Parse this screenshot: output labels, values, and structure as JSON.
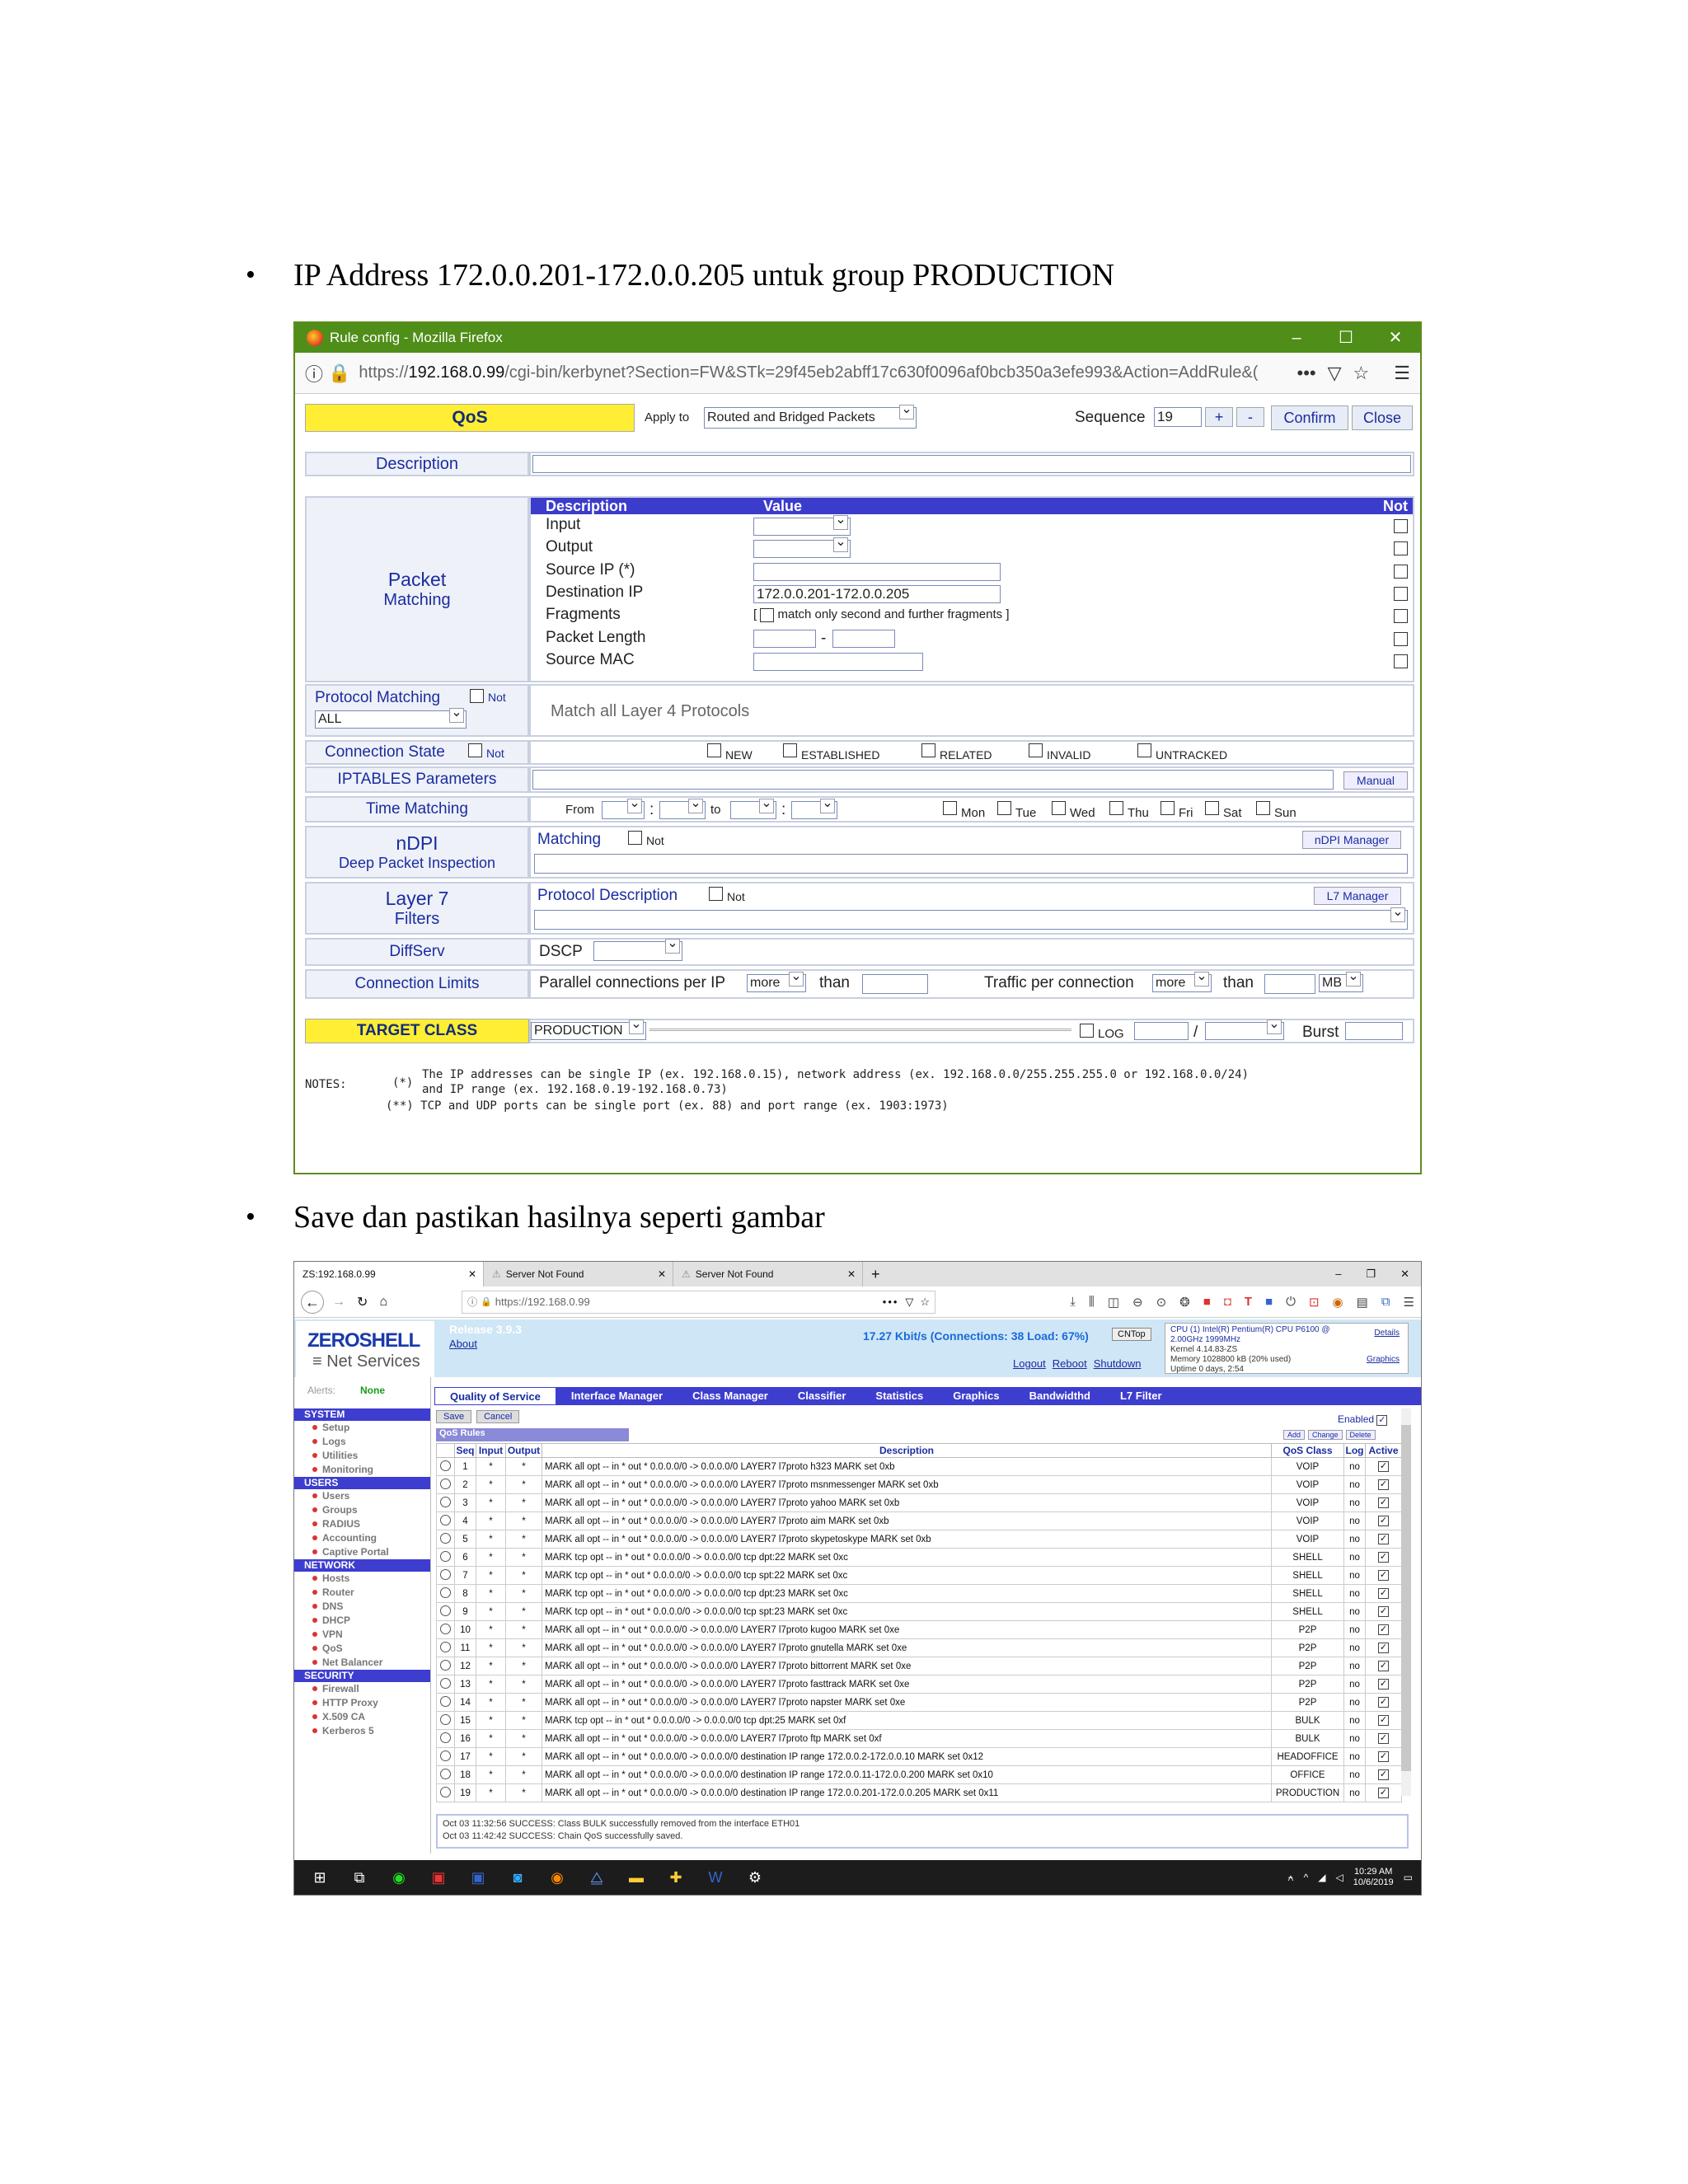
{
  "bullets": [
    "IP Address 172.0.0.201-172.0.0.205 untuk group PRODUCTION",
    "Save dan pastikan hasilnya seperti gambar"
  ],
  "win1": {
    "title": "Rule config - Mozilla Firefox",
    "url_prefix": "https://",
    "url_host": "192.168.0.99",
    "url_rest": "/cgi-bin/kerbynet?Section=FW&STk=29f45eb2abff17c630f0096af0bcb350a3efe993&Action=AddRule&(",
    "qos": "QoS",
    "apply_to": "Apply to",
    "apply_value": "Routed and Bridged Packets",
    "sequence_label": "Sequence",
    "sequence_value": "19",
    "plus": "+",
    "minus": "-",
    "confirm": "Confirm",
    "close": "Close",
    "description": "Description",
    "packet": "Packet",
    "matching": "Matching",
    "pm_head_desc": "Description",
    "pm_head_val": "Value",
    "pm_head_not": "Not",
    "pm_rows": [
      "Input",
      "Output",
      "Source IP (*)",
      "Destination IP",
      "Fragments",
      "Packet Length",
      "Source MAC"
    ],
    "dest_ip": "172.0.0.201-172.0.0.205",
    "frag_text": "match only second and further fragments",
    "protocol_matching": "Protocol Matching",
    "not": "Not",
    "proto_value": "ALL",
    "proto_desc": "Match all Layer 4 Protocols",
    "conn_state": "Connection State",
    "states": [
      "NEW",
      "ESTABLISHED",
      "RELATED",
      "INVALID",
      "UNTRACKED"
    ],
    "iptables": "IPTABLES Parameters",
    "manual": "Manual",
    "time_matching": "Time Matching",
    "from": "From",
    "to": "to",
    "days": [
      "Mon",
      "Tue",
      "Wed",
      "Thu",
      "Fri",
      "Sat",
      "Sun"
    ],
    "ndpi": "nDPI",
    "ndpi_sub": "Deep Packet Inspection",
    "ndpi_matching": "Matching",
    "ndpi_manager": "nDPI Manager",
    "layer7": "Layer 7",
    "filters": "Filters",
    "proto_description": "Protocol Description",
    "l7_manager": "L7 Manager",
    "diffserv": "DiffServ",
    "dscp": "DSCP",
    "conn_limits": "Connection Limits",
    "parallel": "Parallel connections per IP",
    "more": "more",
    "than": "than",
    "traffic": "Traffic per connection",
    "mb": "MB",
    "target_class": "TARGET CLASS",
    "target_value": "PRODUCTION",
    "log": "LOG",
    "slash": "/",
    "burst": "Burst",
    "notes_label": "NOTES:",
    "note1_mark": "(*)",
    "note1a": "The IP addresses can be single IP (ex. 192.168.0.15), network address (ex. 192.168.0.0/255.255.255.0 or 192.168.0.0/24)",
    "note1b": "and IP range (ex. 192.168.0.19-192.168.0.73)",
    "note2": "(**) TCP and UDP ports can be single port (ex. 88) and port range (ex. 1903:1973)"
  },
  "win2": {
    "tabs": [
      "ZS:192.168.0.99",
      "Server Not Found",
      "Server Not Found"
    ],
    "url": "https://192.168.0.99",
    "logo": "ZEROSHELL",
    "logo_sub": "Net Services",
    "release": "Release 3.9.3",
    "about": "About",
    "stats": "17.27 Kbit/s (Connections: 38 Load: 67%)",
    "cntop": "CNTop",
    "cpu": "CPU (1)  Intel(R) Pentium(R) CPU P6100 @ 2.00GHz 1999MHz",
    "kernel": "Kernel   4.14.83-ZS",
    "memory": "Memory  1028800 kB (20% used)",
    "uptime": "Uptime   0 days, 2:54",
    "details": "Details",
    "graphics": "Graphics",
    "logout": "Logout",
    "reboot": "Reboot",
    "shutdown": "Shutdown",
    "alerts": "Alerts:",
    "alerts_val": "None",
    "menu": [
      {
        "cat": "SYSTEM",
        "items": [
          "Setup",
          "Logs",
          "Utilities",
          "Monitoring"
        ]
      },
      {
        "cat": "USERS",
        "items": [
          "Users",
          "Groups",
          "RADIUS",
          "Accounting",
          "Captive Portal"
        ]
      },
      {
        "cat": "NETWORK",
        "items": [
          "Hosts",
          "Router",
          "DNS",
          "DHCP",
          "VPN",
          "QoS",
          "Net Balancer"
        ]
      },
      {
        "cat": "SECURITY",
        "items": [
          "Firewall",
          "HTTP Proxy",
          "X.509 CA",
          "Kerberos 5"
        ]
      }
    ],
    "main_tabs": [
      "Quality of Service",
      "Interface Manager",
      "Class Manager",
      "Classifier",
      "Statistics",
      "Graphics",
      "Bandwidthd",
      "L7 Filter"
    ],
    "save": "Save",
    "cancel": "Cancel",
    "enabled": "Enabled",
    "qos_rules": "QoS Rules",
    "add": "Add",
    "change": "Change",
    "delete": "Delete",
    "cols": [
      "Seq",
      "Input",
      "Output",
      "Description",
      "QoS Class",
      "Log",
      "Active"
    ],
    "rows": [
      [
        "1",
        "MARK all opt -- in * out * 0.0.0.0/0 -> 0.0.0.0/0 LAYER7 l7proto h323 MARK set 0xb",
        "VOIP"
      ],
      [
        "2",
        "MARK all opt -- in * out * 0.0.0.0/0 -> 0.0.0.0/0 LAYER7 l7proto msnmessenger MARK set 0xb",
        "VOIP"
      ],
      [
        "3",
        "MARK all opt -- in * out * 0.0.0.0/0 -> 0.0.0.0/0 LAYER7 l7proto yahoo MARK set 0xb",
        "VOIP"
      ],
      [
        "4",
        "MARK all opt -- in * out * 0.0.0.0/0 -> 0.0.0.0/0 LAYER7 l7proto aim MARK set 0xb",
        "VOIP"
      ],
      [
        "5",
        "MARK all opt -- in * out * 0.0.0.0/0 -> 0.0.0.0/0 LAYER7 l7proto skypetoskype MARK set 0xb",
        "VOIP"
      ],
      [
        "6",
        "MARK tcp opt -- in * out * 0.0.0.0/0 -> 0.0.0.0/0 tcp dpt:22 MARK set 0xc",
        "SHELL"
      ],
      [
        "7",
        "MARK tcp opt -- in * out * 0.0.0.0/0 -> 0.0.0.0/0 tcp spt:22 MARK set 0xc",
        "SHELL"
      ],
      [
        "8",
        "MARK tcp opt -- in * out * 0.0.0.0/0 -> 0.0.0.0/0 tcp dpt:23 MARK set 0xc",
        "SHELL"
      ],
      [
        "9",
        "MARK tcp opt -- in * out * 0.0.0.0/0 -> 0.0.0.0/0 tcp spt:23 MARK set 0xc",
        "SHELL"
      ],
      [
        "10",
        "MARK all opt -- in * out * 0.0.0.0/0 -> 0.0.0.0/0 LAYER7 l7proto kugoo MARK set 0xe",
        "P2P"
      ],
      [
        "11",
        "MARK all opt -- in * out * 0.0.0.0/0 -> 0.0.0.0/0 LAYER7 l7proto gnutella MARK set 0xe",
        "P2P"
      ],
      [
        "12",
        "MARK all opt -- in * out * 0.0.0.0/0 -> 0.0.0.0/0 LAYER7 l7proto bittorrent MARK set 0xe",
        "P2P"
      ],
      [
        "13",
        "MARK all opt -- in * out * 0.0.0.0/0 -> 0.0.0.0/0 LAYER7 l7proto fasttrack MARK set 0xe",
        "P2P"
      ],
      [
        "14",
        "MARK all opt -- in * out * 0.0.0.0/0 -> 0.0.0.0/0 LAYER7 l7proto napster MARK set 0xe",
        "P2P"
      ],
      [
        "15",
        "MARK tcp opt -- in * out * 0.0.0.0/0 -> 0.0.0.0/0 tcp dpt:25 MARK set 0xf",
        "BULK"
      ],
      [
        "16",
        "MARK all opt -- in * out * 0.0.0.0/0 -> 0.0.0.0/0 LAYER7 l7proto ftp MARK set 0xf",
        "BULK"
      ],
      [
        "17",
        "MARK all opt -- in * out * 0.0.0.0/0 -> 0.0.0.0/0 destination IP range 172.0.0.2-172.0.0.10 MARK set 0x12",
        "HEADOFFICE"
      ],
      [
        "18",
        "MARK all opt -- in * out * 0.0.0.0/0 -> 0.0.0.0/0 destination IP range 172.0.0.11-172.0.0.200 MARK set 0x10",
        "OFFICE"
      ],
      [
        "19",
        "MARK all opt -- in * out * 0.0.0.0/0 -> 0.0.0.0/0 destination IP range 172.0.0.201-172.0.0.205 MARK set 0x11",
        "PRODUCTION"
      ]
    ],
    "star": "*",
    "log_no": "no",
    "log1": "Oct 03 11:32:56 SUCCESS: Class BULK successfully removed from the interface ETH01",
    "log2": "Oct 03 11:42:42 SUCCESS: Chain QoS successfully saved.",
    "clock_time": "10:29 AM",
    "clock_date": "10/6/2019"
  }
}
